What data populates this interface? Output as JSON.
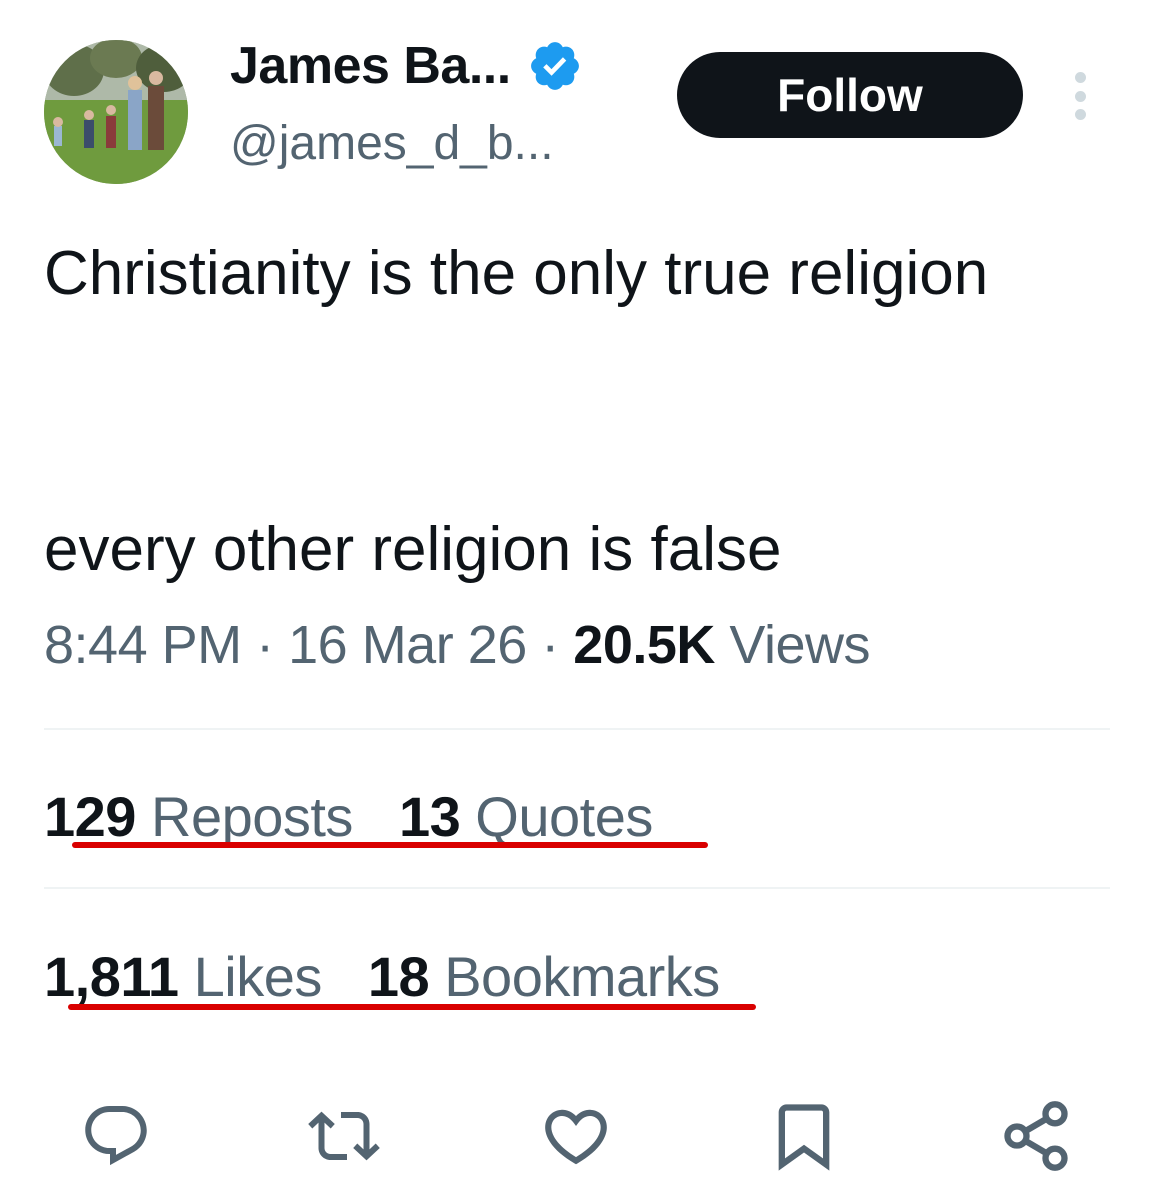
{
  "author": {
    "display_name": "James Ba...",
    "handle": "@james_d_b...",
    "verified": true,
    "follow_label": "Follow"
  },
  "tweet": {
    "text": "Christianity is the only true religion\n\n\nevery other religion is false",
    "time": "8:44 PM",
    "date": "16 Mar 26",
    "views_count": "20.5K",
    "views_label": "Views",
    "separator": "·"
  },
  "stats": {
    "reposts_count": "129",
    "reposts_label": "Reposts",
    "quotes_count": "13",
    "quotes_label": "Quotes",
    "likes_count": "1,811",
    "likes_label": "Likes",
    "bookmarks_count": "18",
    "bookmarks_label": "Bookmarks"
  },
  "actions": [
    "reply-icon",
    "repost-icon",
    "like-icon",
    "bookmark-icon",
    "share-icon"
  ],
  "colors": {
    "text_primary": "#0f1419",
    "text_secondary": "#536471",
    "verified_blue": "#1d9bf0",
    "underline_red": "#d90000"
  }
}
